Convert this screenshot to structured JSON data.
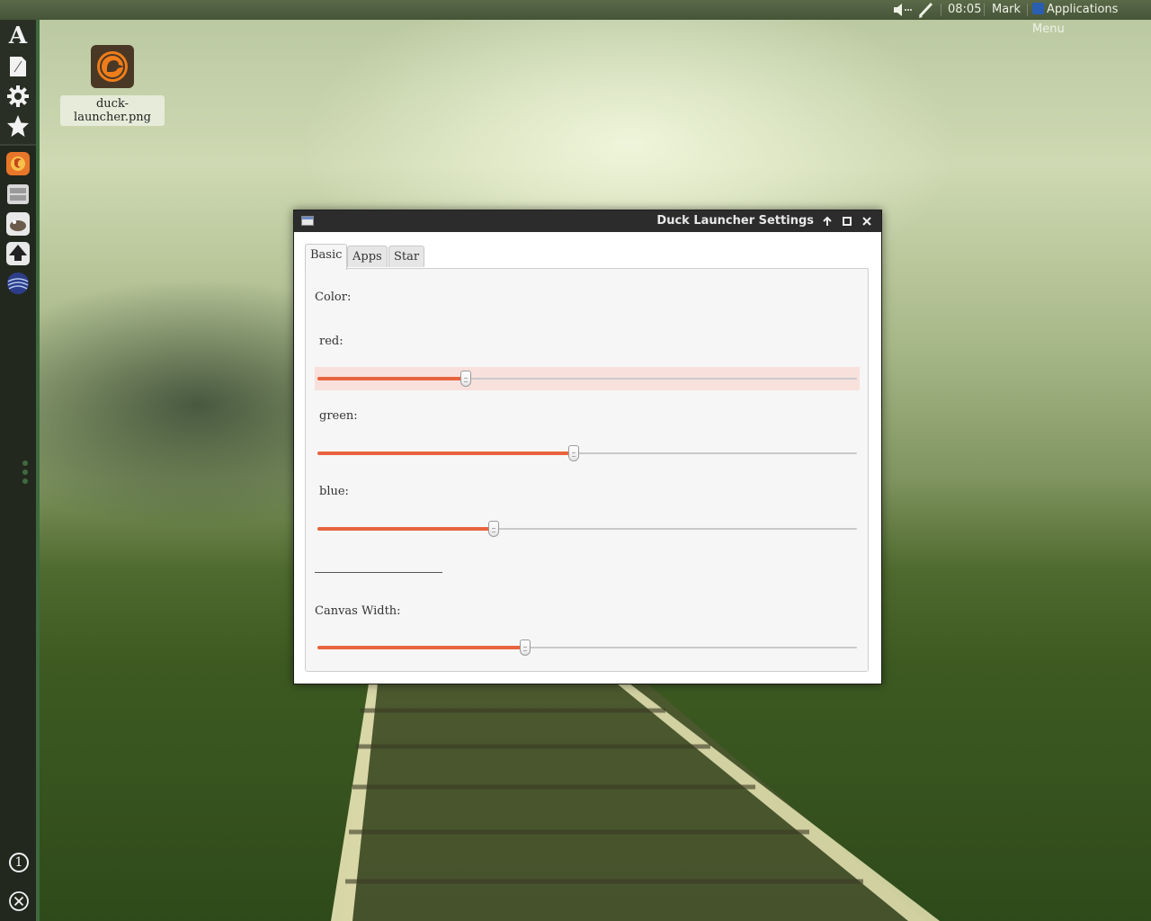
{
  "top_panel": {
    "clock": "08:05",
    "user": "Mark",
    "apps_menu": "Applications Menu",
    "icons": [
      "volume-icon",
      "pen-icon"
    ]
  },
  "dock": {
    "top_icons": [
      "font-icon",
      "document-icon",
      "gear-icon",
      "star-icon"
    ],
    "apps": [
      "firefox-icon",
      "files-icon",
      "gimp-icon",
      "inkscape-icon",
      "globe-icon"
    ],
    "workspace_number": "1"
  },
  "desktop": {
    "file_label": "duck-launcher.png"
  },
  "window": {
    "title": "Duck Launcher Settings",
    "tabs": [
      {
        "label": "Basic",
        "active": true
      },
      {
        "label": "Apps",
        "active": false
      },
      {
        "label": "Star",
        "active": false
      }
    ],
    "color_label": "Color:",
    "sliders": [
      {
        "label": "red:",
        "value": 0.275,
        "highlight": true
      },
      {
        "label": "green:",
        "value": 0.475,
        "highlight": false
      },
      {
        "label": "blue:",
        "value": 0.327,
        "highlight": false
      }
    ],
    "canvas_width_label": "Canvas Width:",
    "canvas_width_value": 0.385
  },
  "colors": {
    "accent": "#e8643e",
    "dock_border": "#3e6a3e",
    "titlebar": "#2c2c2c"
  }
}
